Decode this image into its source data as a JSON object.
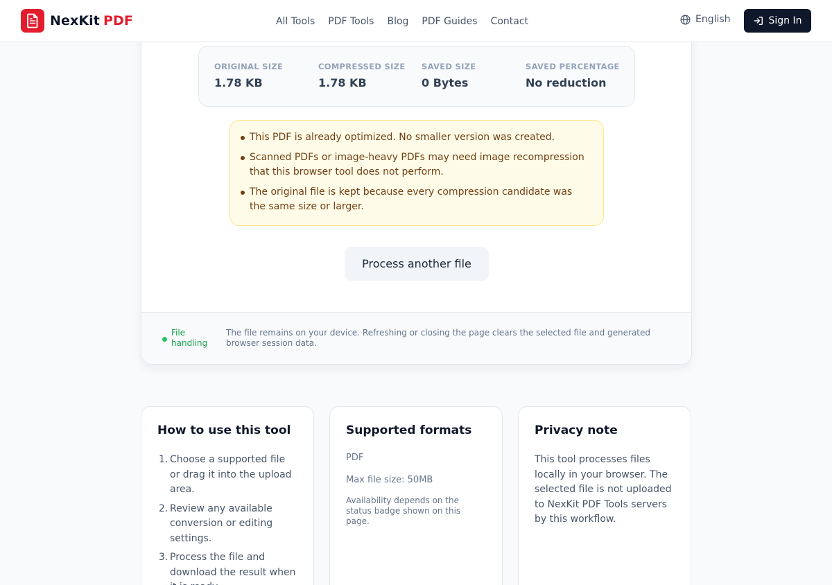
{
  "header": {
    "brand_name": "NexKit",
    "brand_accent": "PDF",
    "nav": [
      "All Tools",
      "PDF Tools",
      "Blog",
      "PDF Guides",
      "Contact"
    ],
    "language": "English",
    "sign_in": "Sign In"
  },
  "stats": [
    {
      "label": "ORIGINAL SIZE",
      "value": "1.78 KB"
    },
    {
      "label": "COMPRESSED SIZE",
      "value": "1.78 KB"
    },
    {
      "label": "SAVED SIZE",
      "value": "0 Bytes"
    },
    {
      "label": "SAVED PERCENTAGE",
      "value": "No reduction"
    }
  ],
  "notices": [
    "This PDF is already optimized. No smaller version was created.",
    "Scanned PDFs or image-heavy PDFs may need image recompression that this browser tool does not perform.",
    "The original file is kept because every compression candidate was the same size or larger."
  ],
  "process_button": "Process another file",
  "file_handling": {
    "label": "File handling",
    "text": "The file remains on your device. Refreshing or closing the page clears the selected file and generated browser session data."
  },
  "how_to": {
    "title": "How to use this tool",
    "steps": [
      "Choose a supported file or drag it into the upload area.",
      "Review any available conversion or editing settings.",
      "Process the file and download the result when it is ready."
    ]
  },
  "formats": {
    "title": "Supported formats",
    "format": "PDF",
    "max_size": "Max file size: 50MB",
    "note": "Availability depends on the status badge shown on this page."
  },
  "privacy": {
    "title": "Privacy note",
    "text": "This tool processes files locally in your browser. The selected file is not uploaded to NexKit PDF Tools servers by this workflow."
  },
  "colors": {
    "brand": "#e11d2e",
    "dark": "#0f172a",
    "notice_bg": "#fefce8",
    "notice_text": "#713f12",
    "status_green": "#22c55e"
  }
}
